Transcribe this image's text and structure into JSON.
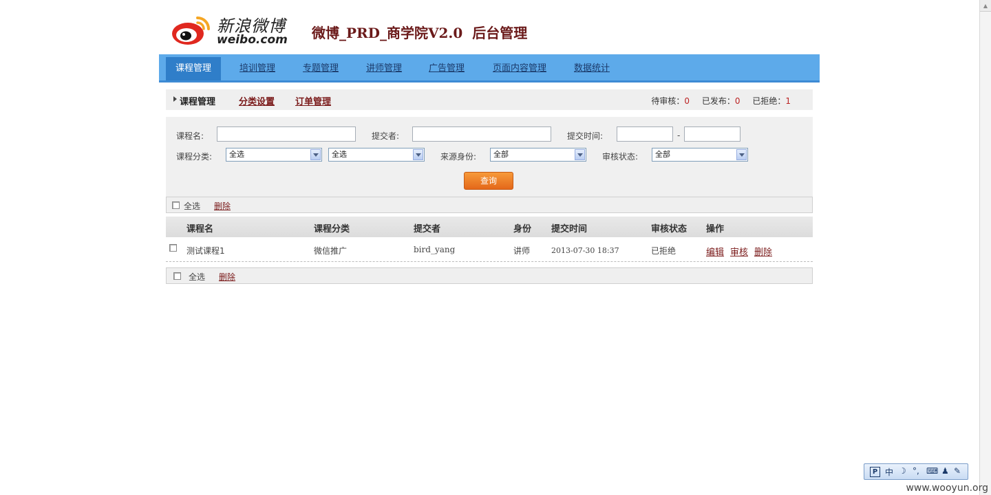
{
  "header": {
    "logo_cn": "新浪微博",
    "logo_en": "weibo.com",
    "title": "微博_PRD_商学院V2.0  后台管理"
  },
  "nav": {
    "items": [
      {
        "label": "课程管理"
      },
      {
        "label": "培训管理"
      },
      {
        "label": "专题管理"
      },
      {
        "label": "讲师管理"
      },
      {
        "label": "广告管理"
      },
      {
        "label": "页面内容管理"
      },
      {
        "label": "数据统计"
      }
    ],
    "active_index": 0
  },
  "subnav": {
    "current": "课程管理",
    "links": [
      "分类设置",
      "订单管理"
    ],
    "stats": {
      "pending_label": "待审核：",
      "pending": "0",
      "published_label": "已发布：",
      "published": "0",
      "rejected_label": "已拒绝：",
      "rejected": "1"
    }
  },
  "search": {
    "course_name_label": "课程名:",
    "submitter_label": "提交者:",
    "submit_time_label": "提交时间:",
    "time_separator": "-",
    "category_label": "课程分类:",
    "category1_value": "全选",
    "category2_value": "全选",
    "source_label": "来源身份:",
    "source_value": "全部",
    "status_label": "审核状态:",
    "status_value": "全部",
    "query_button": "查询"
  },
  "bulk": {
    "select_all": "全选",
    "delete": "删除"
  },
  "table": {
    "headers": [
      "课程名",
      "课程分类",
      "提交者",
      "身份",
      "提交时间",
      "审核状态",
      "操作"
    ],
    "rows": [
      {
        "name": "测试课程1",
        "category": "微信推广",
        "submitter": "bird_yang",
        "identity": "讲师",
        "time": "2013-07-30 18:37",
        "status": "已拒绝",
        "actions": [
          "编辑",
          "审核",
          "删除"
        ]
      }
    ]
  },
  "ime": {
    "mode": "中"
  },
  "watermark": "www.wooyun.org",
  "colors": {
    "nav_bg": "#5daaea",
    "nav_active": "#2f7ec9",
    "title": "#6b1a1a",
    "link": "#7a1a1a",
    "query_button": "#e4681a",
    "logo_red": "#e0281f",
    "logo_orange": "#f5a623"
  }
}
